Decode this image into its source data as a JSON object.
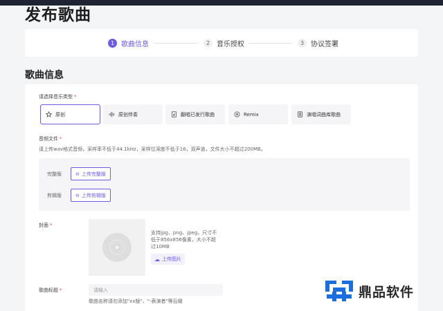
{
  "page": {
    "title": "发布歌曲",
    "section_title": "歌曲信息"
  },
  "steps": [
    {
      "num": "1",
      "label": "歌曲信息",
      "active": true
    },
    {
      "num": "2",
      "label": "音乐授权",
      "active": false
    },
    {
      "num": "3",
      "label": "协议签署",
      "active": false
    }
  ],
  "music_type": {
    "label": "请选择音乐类型",
    "required_mark": "*",
    "options": [
      {
        "label": "原创",
        "icon": "star-icon",
        "selected": true
      },
      {
        "label": "原创伴奏",
        "icon": "waveform-icon",
        "selected": false
      },
      {
        "label": "翻唱已发行歌曲",
        "icon": "music-file-icon",
        "selected": false
      },
      {
        "label": "Remix",
        "icon": "disc-icon",
        "selected": false
      },
      {
        "label": "演唱词曲库歌曲",
        "icon": "library-icon",
        "selected": false
      }
    ]
  },
  "audio": {
    "label": "音频文件",
    "required_mark": "*",
    "hint": "请上传wav格式音频，采样率不低于44.1kHz，采样位深度不低于16，双声道，文件大小不超过200MB。",
    "full_version": {
      "label": "完整版",
      "button": "上传完整版"
    },
    "clip_version": {
      "label": "剪辑版",
      "button": "上传剪辑版"
    }
  },
  "cover": {
    "label": "封面",
    "required_mark": "*",
    "hint": "支持jpg、png、jpeg，尺寸不低于856x856像素，大小不超过10MB",
    "button": "上传图片"
  },
  "song_title": {
    "label": "歌曲标题",
    "required_mark": "*",
    "placeholder": "请输入",
    "hint": "歌曲名称请勿添加\"xx版\"、\"-表演者\"等后缀"
  },
  "watermark": {
    "text": "鼎品软件"
  },
  "colors": {
    "accent": "#6b5ce7",
    "required": "#e5484d",
    "topbar": "#1f2433"
  }
}
